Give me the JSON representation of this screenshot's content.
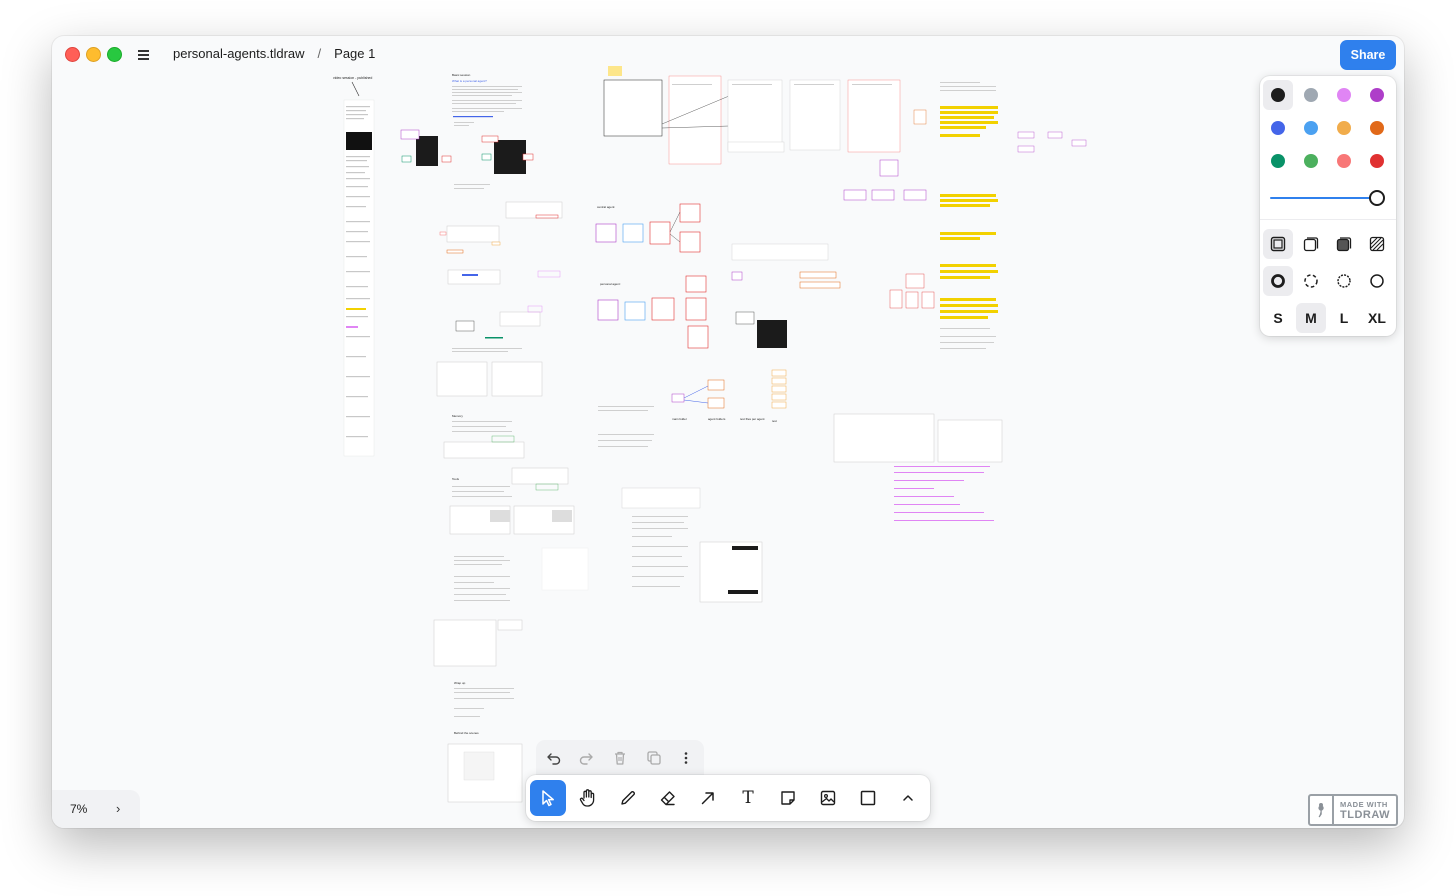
{
  "window": {
    "file_name": "personal-agents.tldraw",
    "separator": "/",
    "page_name": "Page 1",
    "share_label": "Share"
  },
  "canvas": {
    "column_title": "video session - published",
    "sections": [
      {
        "label": "Basic session"
      },
      {
        "label": "What is a personal agent?"
      },
      {
        "label": "central agent:"
      },
      {
        "label": "personal agent:"
      },
      {
        "label": "Memory"
      },
      {
        "label": "Tools"
      },
      {
        "label": "Wrap up"
      },
      {
        "label": "Behind the scenes"
      }
    ],
    "folder_labels": [
      "main folder",
      "agent folders",
      "text files per agent",
      "text"
    ]
  },
  "style_panel": {
    "colors": [
      "#1d1d1d",
      "#9fa8b2",
      "#e085f4",
      "#ae3ec9",
      "#4465e9",
      "#4ba1f1",
      "#f1ac4b",
      "#e16919",
      "#099268",
      "#4cb05e",
      "#f87777",
      "#e03131"
    ],
    "selected_color_index": 0,
    "opacity_percent": 100,
    "sizes": [
      "S",
      "M",
      "L",
      "XL"
    ],
    "selected_size": "M"
  },
  "toolbar": {
    "tools": [
      "select-tool",
      "hand-tool",
      "draw-tool",
      "eraser-tool",
      "arrow-tool",
      "text-tool",
      "note-tool",
      "image-tool",
      "rectangle-tool",
      "more-tools"
    ],
    "selected_tool": "select-tool",
    "text_tool_glyph": "T"
  },
  "zoom": {
    "value": "7%",
    "expand_glyph": "›"
  },
  "badge": {
    "line1": "MADE WITH",
    "line2": "TLDRAW"
  }
}
